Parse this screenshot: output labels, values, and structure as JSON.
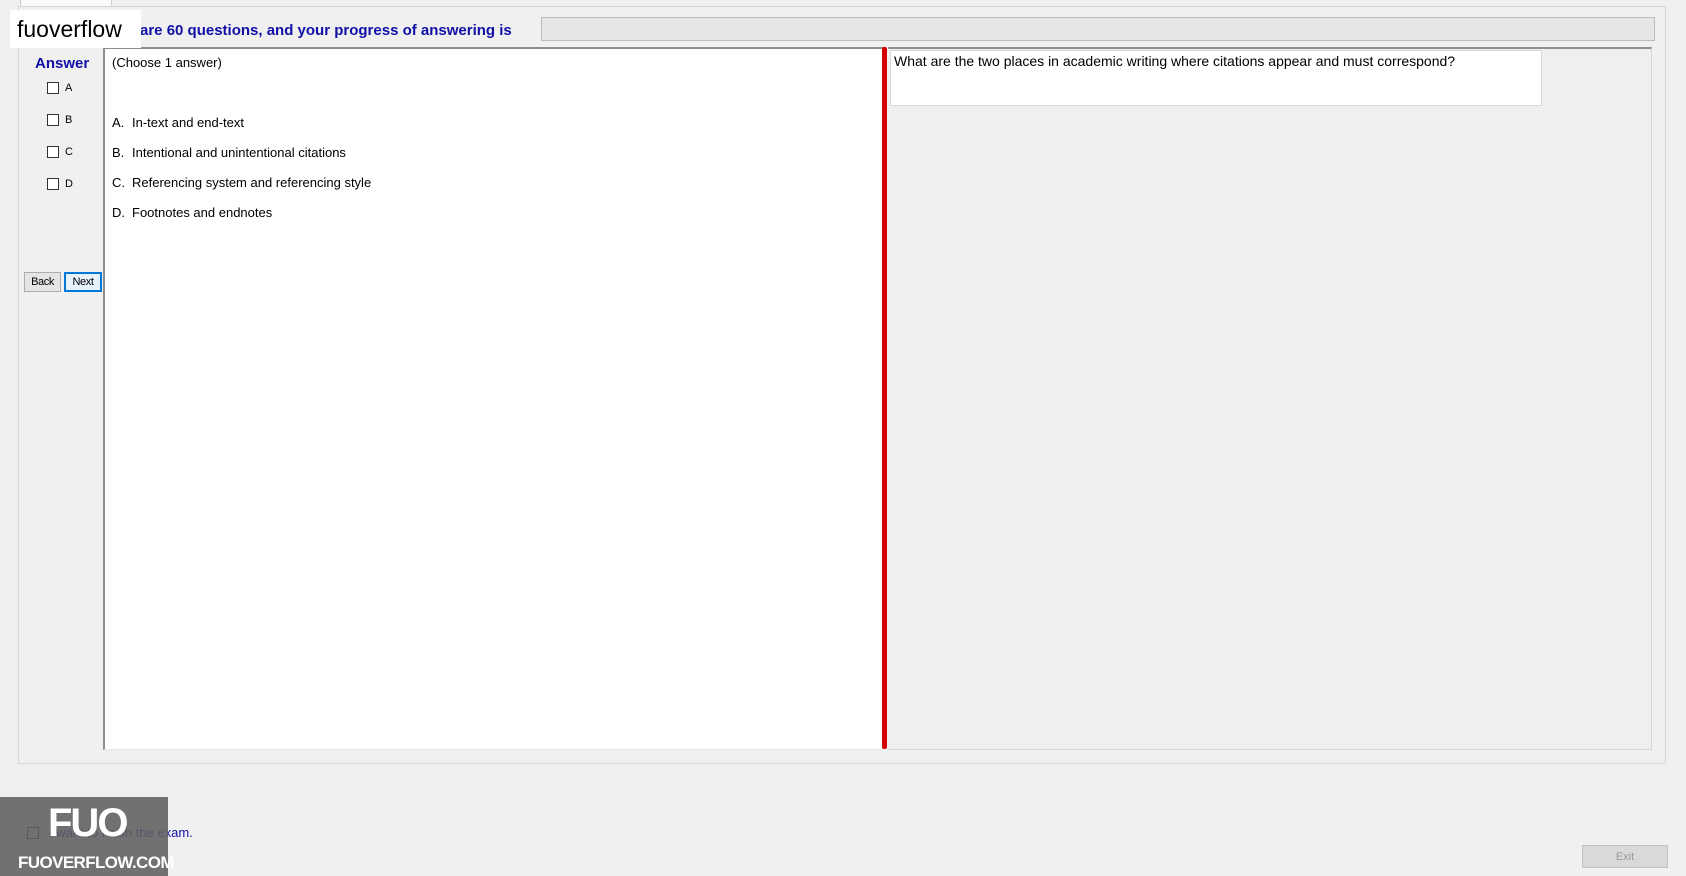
{
  "header": {
    "progress_text": "are 60 questions, and your progress of answering is",
    "progress": 0
  },
  "answer_panel": {
    "heading": "Answer",
    "options": [
      {
        "letter": "A",
        "checked": false
      },
      {
        "letter": "B",
        "checked": false
      },
      {
        "letter": "C",
        "checked": false
      },
      {
        "letter": "D",
        "checked": false
      }
    ],
    "back_label": "Back",
    "next_label": "Next"
  },
  "choices": {
    "hint": "(Choose 1 answer)",
    "items": [
      {
        "letter": "A.",
        "text": "In-text and end-text"
      },
      {
        "letter": "B.",
        "text": "Intentional and unintentional citations"
      },
      {
        "letter": "C.",
        "text": "Referencing system and referencing style"
      },
      {
        "letter": "D.",
        "text": "Footnotes and endnotes"
      }
    ]
  },
  "question": {
    "text": "What are the two places in academic writing where citations appear and must correspond?"
  },
  "footer": {
    "finish_label": "I want to finish the exam.",
    "exit_label": "Exit"
  },
  "watermark": {
    "site_name": "fuoverflow",
    "logo_big": "FUO",
    "logo_small": "FUOVERFLOW.COM"
  },
  "colors": {
    "accent_text": "#1010a8",
    "splitter": "#d40000",
    "focus_border": "#0078d7"
  }
}
